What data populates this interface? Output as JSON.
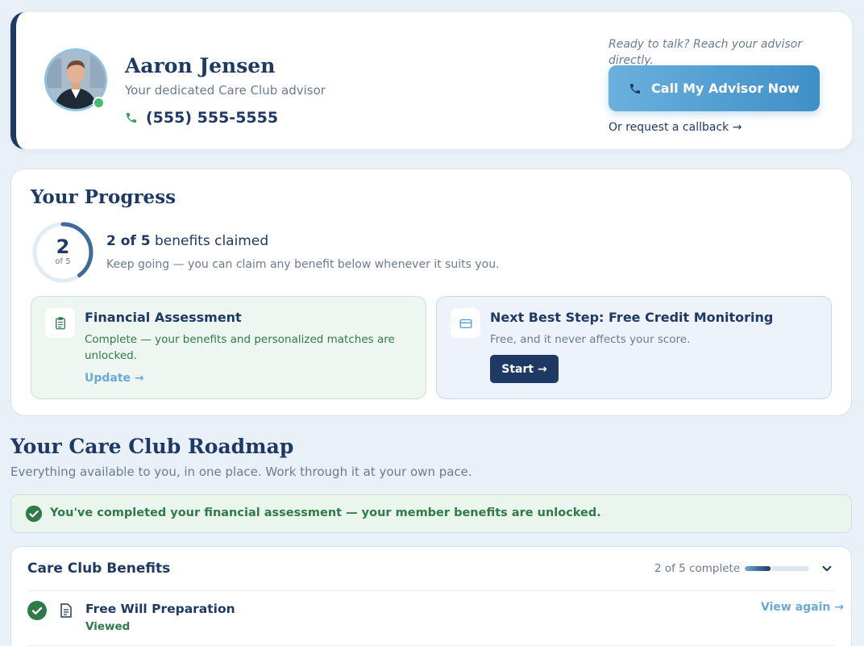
{
  "advisor": {
    "name": "Aaron Jensen",
    "subtitle": "Your dedicated Care Club advisor",
    "phone": "(555) 555-5555",
    "ready_text": "Ready to talk? Reach your advisor directly.",
    "call_label": "Call My Advisor Now",
    "callback_label": "Or request a callback →",
    "status": "online",
    "icons": {
      "phone": "phone-icon",
      "online": "online-status-dot"
    }
  },
  "progress": {
    "title": "Your Progress",
    "claimed": 2,
    "total": 5,
    "ring_number": "2",
    "ring_of": "of 5",
    "claimed_strong": "2 of 5",
    "claimed_rest": " benefits claimed",
    "keep_going": "Keep going — you can claim any benefit below whenever it suits you.",
    "assessment": {
      "title": "Financial Assessment",
      "desc": "Complete — your benefits and personalized matches are unlocked.",
      "link": "Update →",
      "icon": "clipboard-check-icon"
    },
    "next_step": {
      "title": "Next Best Step: Free Credit Monitoring",
      "desc": "Free, and it never affects your score.",
      "button": "Start →",
      "icon": "credit-card-icon"
    }
  },
  "roadmap": {
    "title": "Your Care Club Roadmap",
    "subtitle": "Everything available to you, in one place. Work through it at your own pace.",
    "banner": "You've completed your financial assessment — your member benefits are unlocked.",
    "benefits": {
      "title": "Care Club Benefits",
      "count_label": "2 of 5 complete",
      "progress_fraction": 0.4,
      "items": [
        {
          "title": "Free Will Preparation",
          "status": "Viewed",
          "action": "View again →",
          "icon": "document-icon"
        }
      ]
    }
  },
  "colors": {
    "navy": "#1e3a64",
    "accent_blue": "#4a9bd0",
    "green": "#2f7a48",
    "bg": "#eaf0f8"
  }
}
